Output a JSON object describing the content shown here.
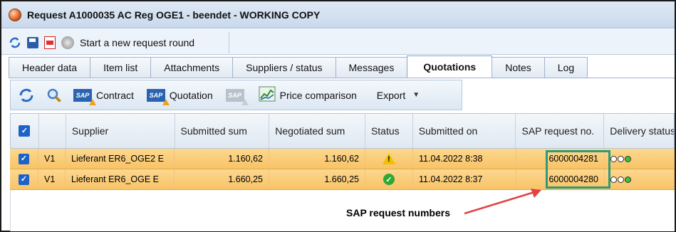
{
  "window": {
    "title": "Request A1000035 AC Reg OGE1 - beendet - WORKING COPY"
  },
  "toolbar": {
    "new_round_label": "Start a new request round"
  },
  "tabs": [
    {
      "label": "Header data"
    },
    {
      "label": "Item list"
    },
    {
      "label": "Attachments"
    },
    {
      "label": "Suppliers / status"
    },
    {
      "label": "Messages"
    },
    {
      "label": "Quotations",
      "active": true
    },
    {
      "label": "Notes"
    },
    {
      "label": "Log"
    }
  ],
  "actions": {
    "contract_label": "Contract",
    "quotation_label": "Quotation",
    "price_comparison_label": "Price comparison",
    "export_label": "Export",
    "sap_badge": "SAP"
  },
  "grid": {
    "columns": {
      "supplier": "Supplier",
      "submitted_sum": "Submitted sum",
      "negotiated_sum": "Negotiated sum",
      "status": "Status",
      "submitted_on": "Submitted on",
      "sap_request_no": "SAP request no.",
      "delivery_status": "Delivery status"
    },
    "rows": [
      {
        "version": "V1",
        "supplier": "Lieferant ER6_OGE2 E",
        "submitted_sum": "1.160,62",
        "negotiated_sum": "1.160,62",
        "status": "warning",
        "submitted_on": "11.04.2022 8:38",
        "sap_request_no": "6000004281",
        "delivery_status": "green"
      },
      {
        "version": "V1",
        "supplier": "Lieferant ER6_OGE E",
        "submitted_sum": "1.660,25",
        "negotiated_sum": "1.660,25",
        "status": "ok",
        "submitted_on": "11.04.2022 8:37",
        "sap_request_no": "6000004280",
        "delivery_status": "green"
      }
    ]
  },
  "annotation": {
    "text": "SAP request numbers",
    "color": "#e04444"
  }
}
